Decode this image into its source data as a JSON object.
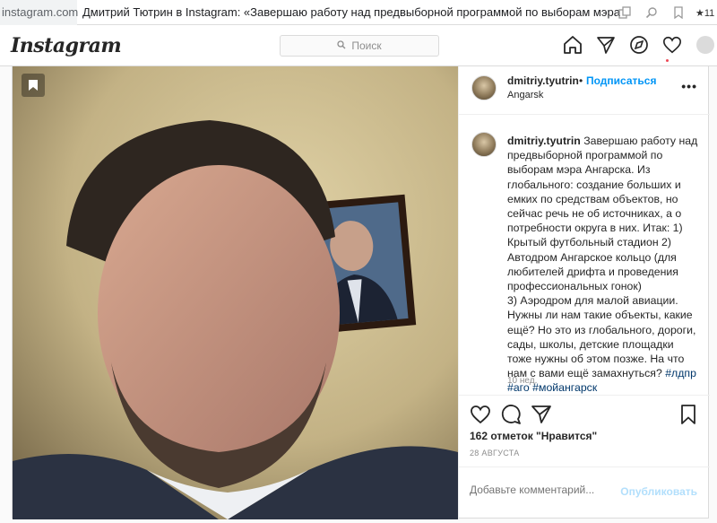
{
  "browser": {
    "url": "instagram.com",
    "tab_title": "Дмитрий Тютрин в Instagram: «Завершаю работу над предвыборной программой по выборам мэра Анг...",
    "ext_badge": "11"
  },
  "header": {
    "logo": "Instagram",
    "search_placeholder": "Поиск"
  },
  "post": {
    "username": "dmitriy.tyutrin",
    "separator": "•",
    "follow_label": "Подписаться",
    "location": "Angarsk",
    "more_label": "•••",
    "caption_text": "Завершаю работу над предвыборной программой по выборам мэра Ангарска. Из глобального: создание больших и емких по средствам объектов, но сейчас речь не об источниках, а о потребности округа в них. Итак: 1) Крытый футбольный стадион 2) Автодром Ангарское кольцо (для любителей дрифта и проведения профессиональных гонок)",
    "caption_text_2": "3) Аэродром для малой авиации. Нужны ли нам такие объекты, какие ещё? Но это из глобального, дороги, сады, школы, детские площадки тоже нужны об этом позже. На что нам с вами ещё замахнуться?",
    "hashtags": [
      "#лдпр",
      "#аго",
      "#мойангарск"
    ],
    "caption_time": "10 нед.",
    "likes": "162 отметок \"Нравится\"",
    "date": "28 АВГУСТА",
    "comment_placeholder": "Добавьте комментарий...",
    "publish_label": "Опубликовать"
  },
  "colors": {
    "link": "#0095f6",
    "hashtag": "#00376b",
    "muted": "#8e8e8e",
    "notification": "#ed4956",
    "publish_disabled": "#b2dffc"
  }
}
